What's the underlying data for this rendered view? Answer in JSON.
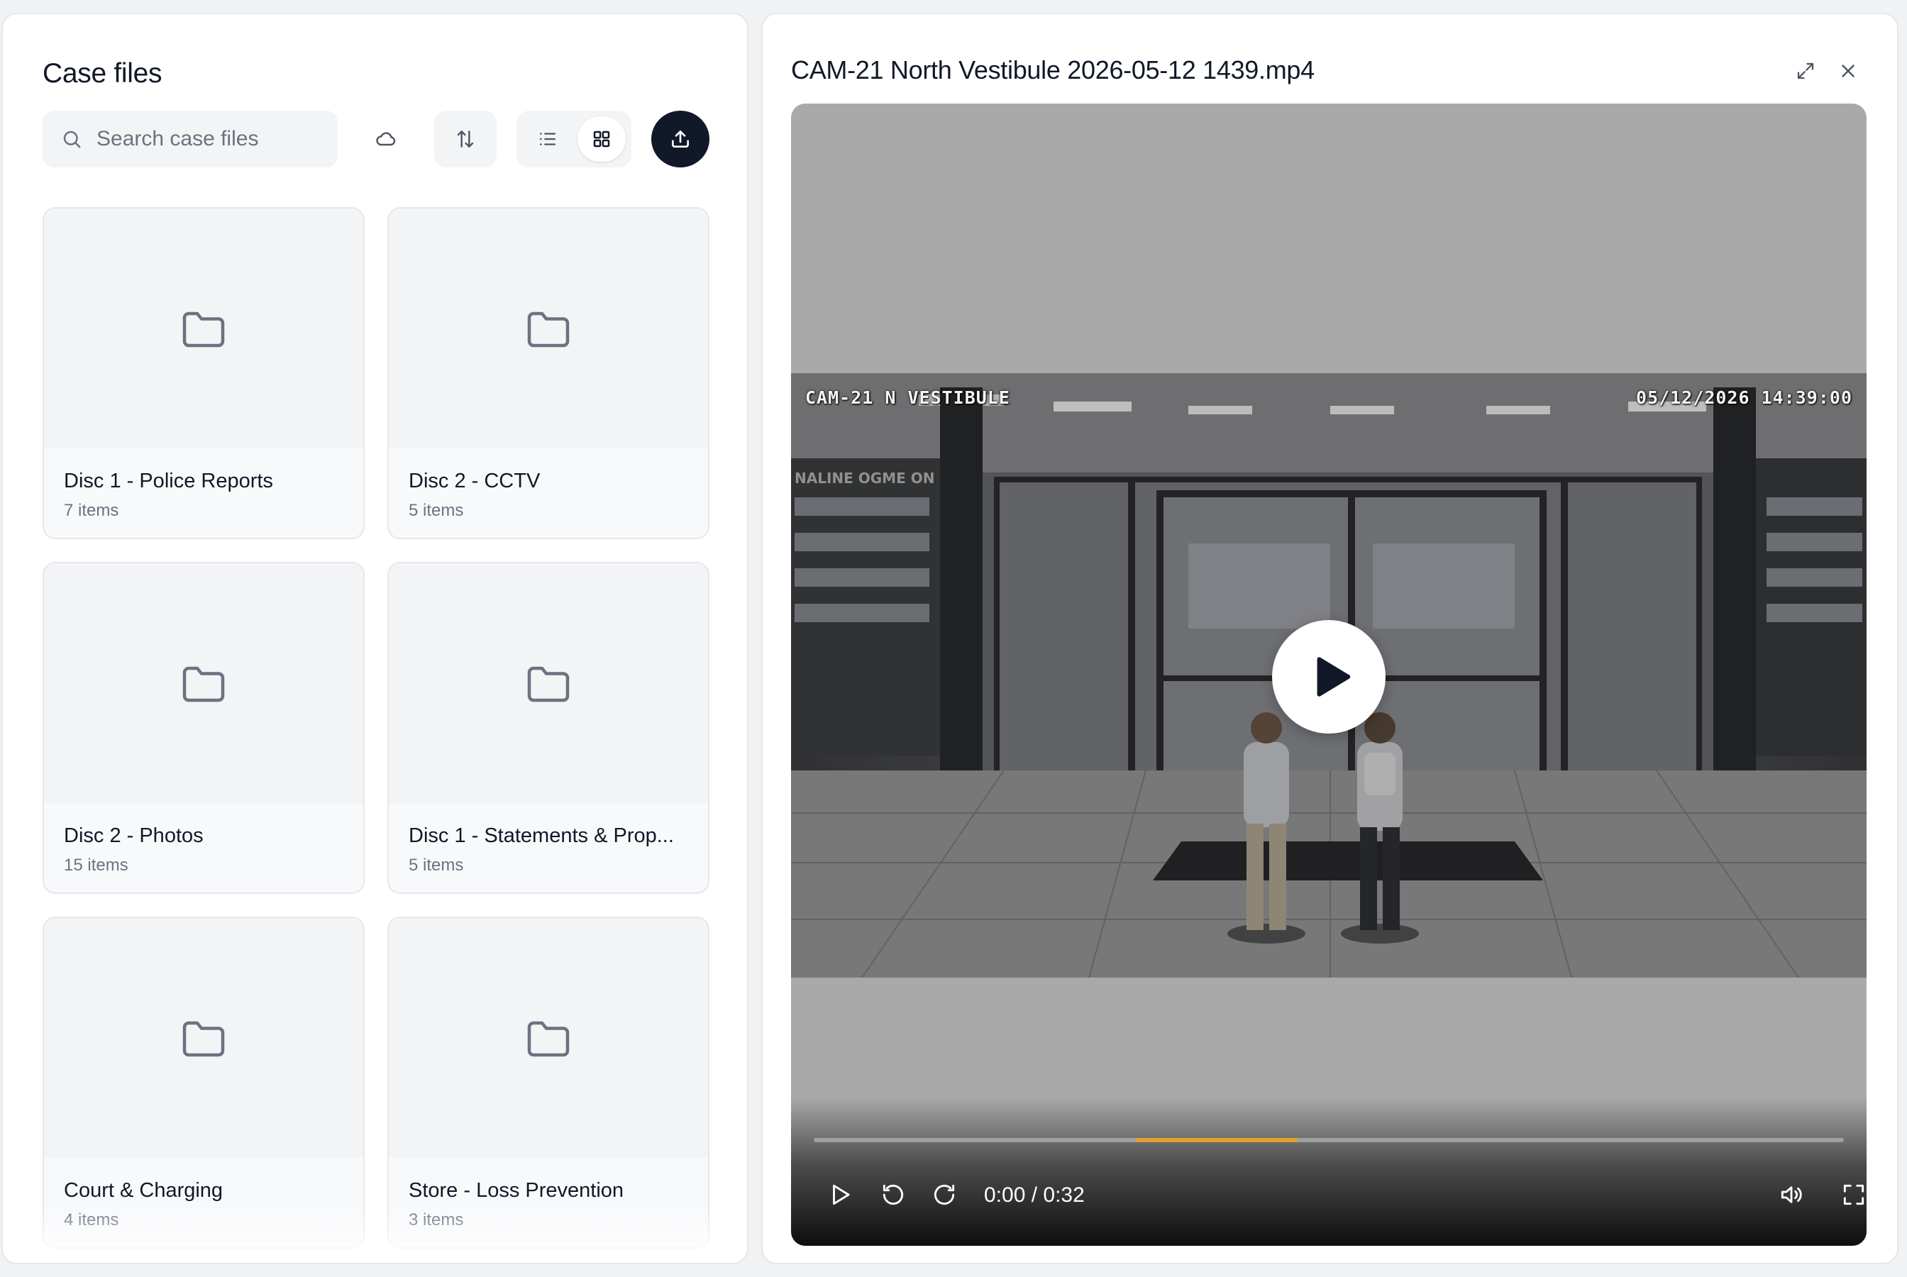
{
  "left_panel": {
    "title": "Case files",
    "search": {
      "placeholder": "Search case files",
      "value": ""
    },
    "icons": {
      "search": "search-icon",
      "cloud": "cloud-icon",
      "sort": "sort-arrows-icon",
      "list_view": "list-icon",
      "grid_view": "grid-icon",
      "upload": "upload-icon"
    },
    "active_view": "grid",
    "folders": [
      {
        "name": "Disc 1 - Police Reports",
        "count": "7 items"
      },
      {
        "name": "Disc 2 - CCTV",
        "count": "5 items"
      },
      {
        "name": "Disc 2 - Photos",
        "count": "15 items"
      },
      {
        "name": "Disc 1 - Statements & Prop...",
        "count": "5 items"
      },
      {
        "name": "Court & Charging",
        "count": "4 items"
      },
      {
        "name": "Store - Loss Prevention",
        "count": "3 items"
      }
    ]
  },
  "viewer": {
    "file_name": "CAM-21 North Vestibule 2026-05-12 1439.mp4",
    "icons": {
      "expand": "expand-icon",
      "close": "close-icon"
    },
    "video": {
      "osd_camera": "CAM-21 N VESTIBULE",
      "osd_timestamp": "05/12/2026 14:39:00",
      "current_time": "0:00",
      "duration": "0:32",
      "time_readout": "0:00 / 0:32",
      "buffered_start_fraction": 0.313,
      "buffered_end_fraction": 0.47,
      "played_fraction": 0.0
    },
    "controls": {
      "play": "play-icon",
      "rewind": "rewind-icon",
      "forward": "forward-icon",
      "volume": "volume-icon",
      "fullscreen": "fullscreen-icon"
    }
  },
  "colors": {
    "accent_dark": "#111827",
    "progress_buffer": "#e0a030",
    "icon_gray": "#6b7280"
  }
}
